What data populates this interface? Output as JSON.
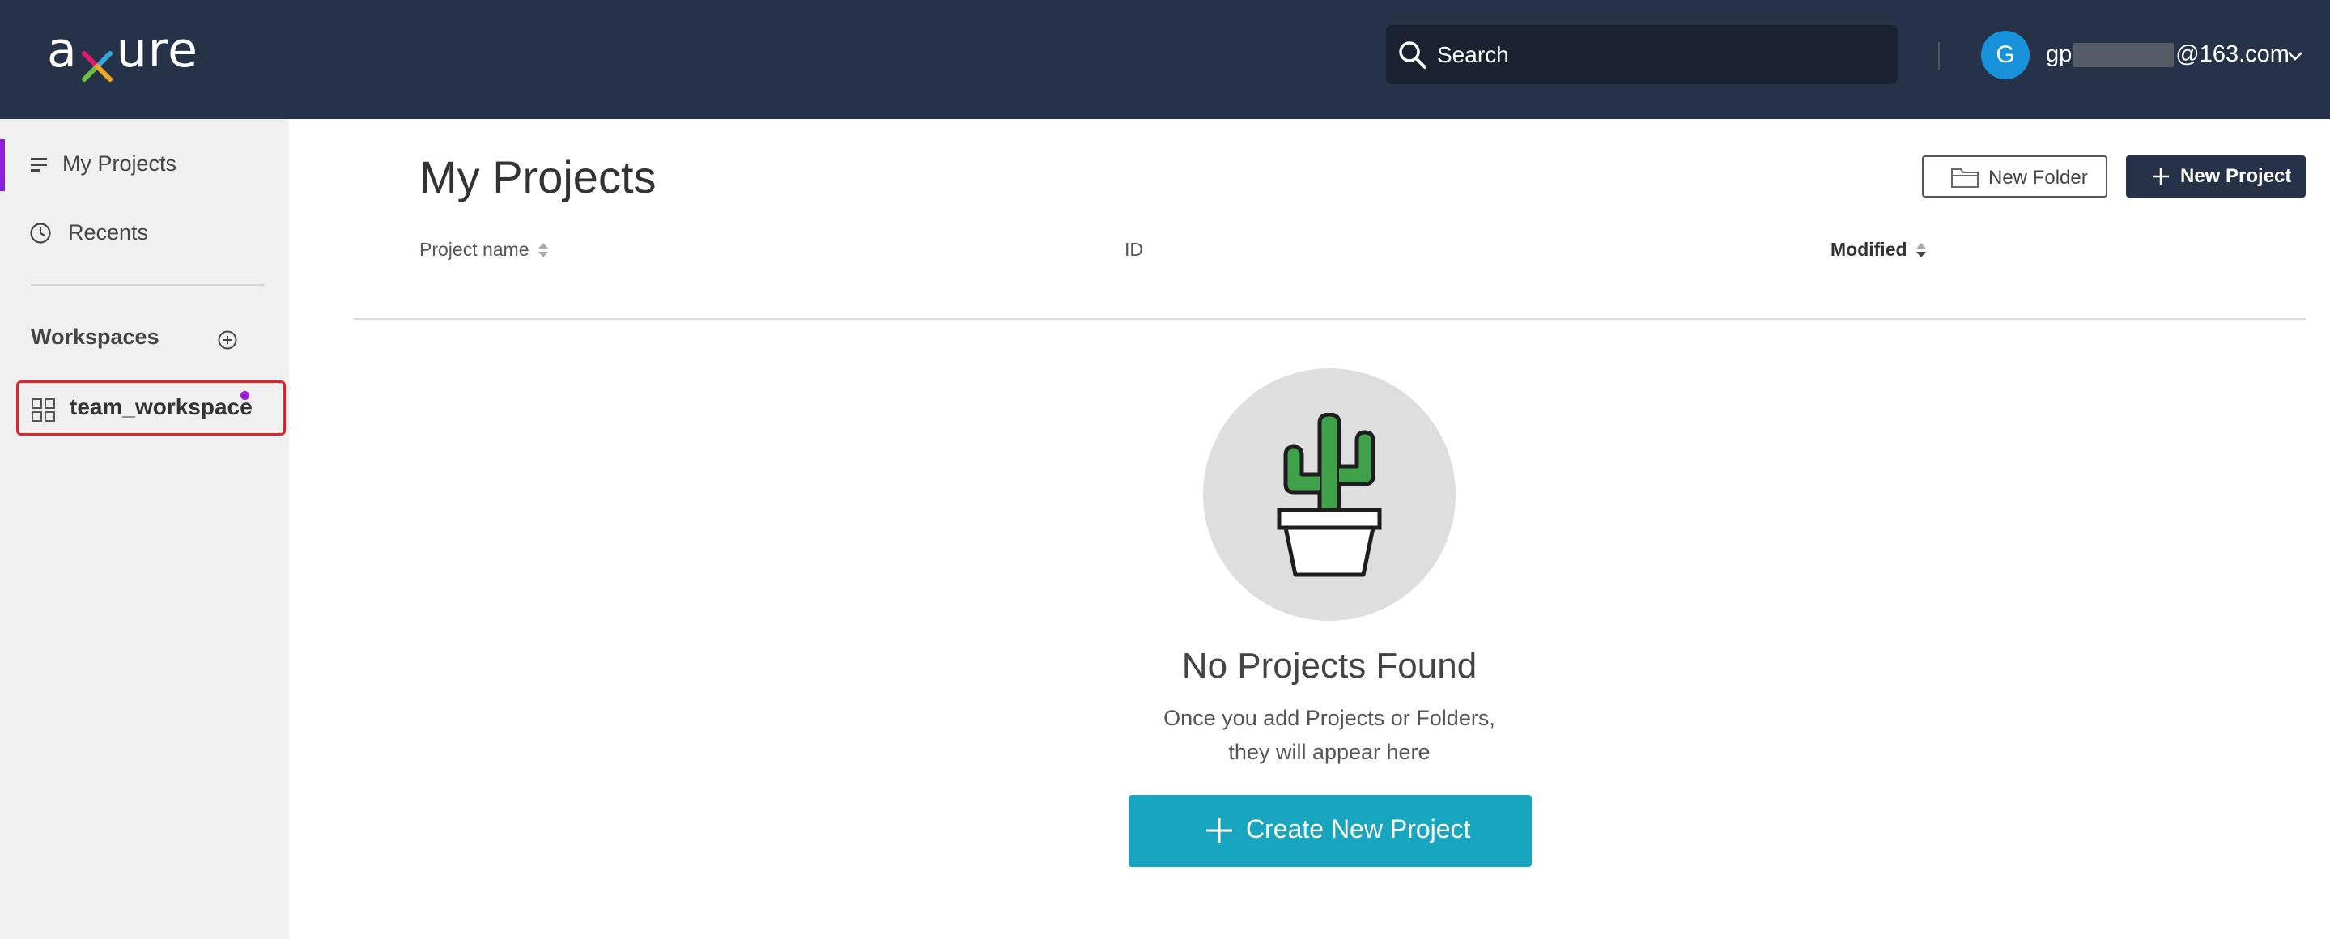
{
  "header": {
    "logo": {
      "pre": "a",
      "post": "ure",
      "x_colors": [
        "#e2196d",
        "#35a6e0",
        "#6fbe44",
        "#f5a623"
      ]
    },
    "search": {
      "placeholder": "Search",
      "icon": "search-icon"
    },
    "user": {
      "avatar_initial": "G",
      "email_prefix": "gp",
      "email_suffix": "@163.com",
      "menu_icon": "chevron-down-icon"
    }
  },
  "sidebar": {
    "items": [
      {
        "label": "My Projects",
        "icon": "list-icon",
        "active": true
      },
      {
        "label": "Recents",
        "icon": "clock-icon",
        "active": false
      }
    ],
    "workspaces": {
      "title": "Workspaces",
      "add_icon": "plus-circle-icon",
      "items": [
        {
          "label": "team_workspace",
          "icon": "grid-icon",
          "has_notification": true
        }
      ]
    },
    "accent_color": "#8d1fd7"
  },
  "main": {
    "title": "My Projects",
    "actions": {
      "new_folder": "New Folder",
      "new_project": "New Project"
    },
    "columns": [
      {
        "label": "Project name",
        "sortable": true
      },
      {
        "label": "ID",
        "sortable": false
      },
      {
        "label": "Modified",
        "sortable": true,
        "sorted": "desc"
      }
    ],
    "empty_state": {
      "illustration": "cactus-pot-icon",
      "title": "No Projects Found",
      "subtitle_line1": "Once you add Projects or Folders,",
      "subtitle_line2": "they will appear here",
      "cta": "Create New Project",
      "cta_color": "#18a5bf"
    }
  },
  "colors": {
    "header_bg": "#263248",
    "sidebar_bg": "#f0f0f0",
    "avatar_bg": "#1791d9",
    "highlight_border": "#e0232b"
  }
}
